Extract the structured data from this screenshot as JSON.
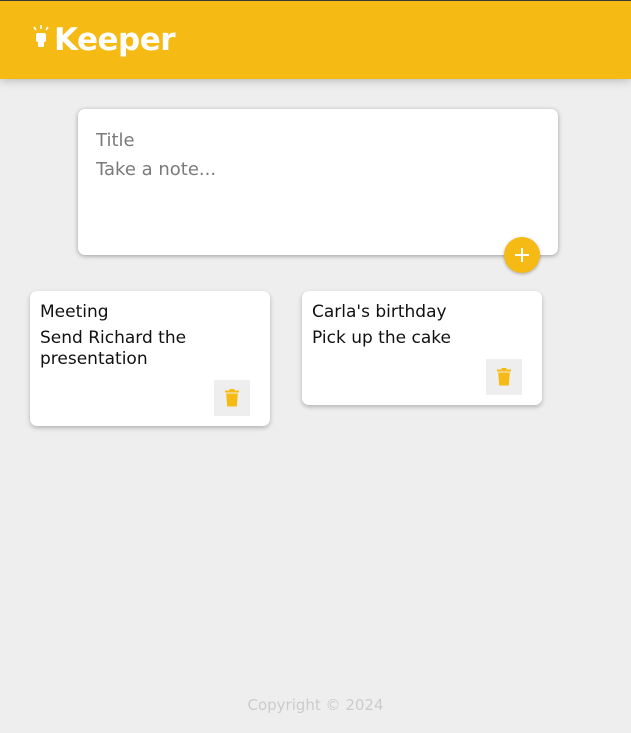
{
  "header": {
    "title": "Keeper",
    "icon": "lightbulb-icon",
    "bg_color": "#f5ba13"
  },
  "create_note": {
    "title_placeholder": "Title",
    "content_placeholder": "Take a note...",
    "add_icon": "plus-icon"
  },
  "notes": [
    {
      "title": "Meeting",
      "content": "Send Richard the presentation",
      "delete_icon": "trash-icon"
    },
    {
      "title": "Carla's birthday",
      "content": "Pick up the cake",
      "delete_icon": "trash-icon"
    }
  ],
  "footer": {
    "text": "Copyright © 2024"
  }
}
